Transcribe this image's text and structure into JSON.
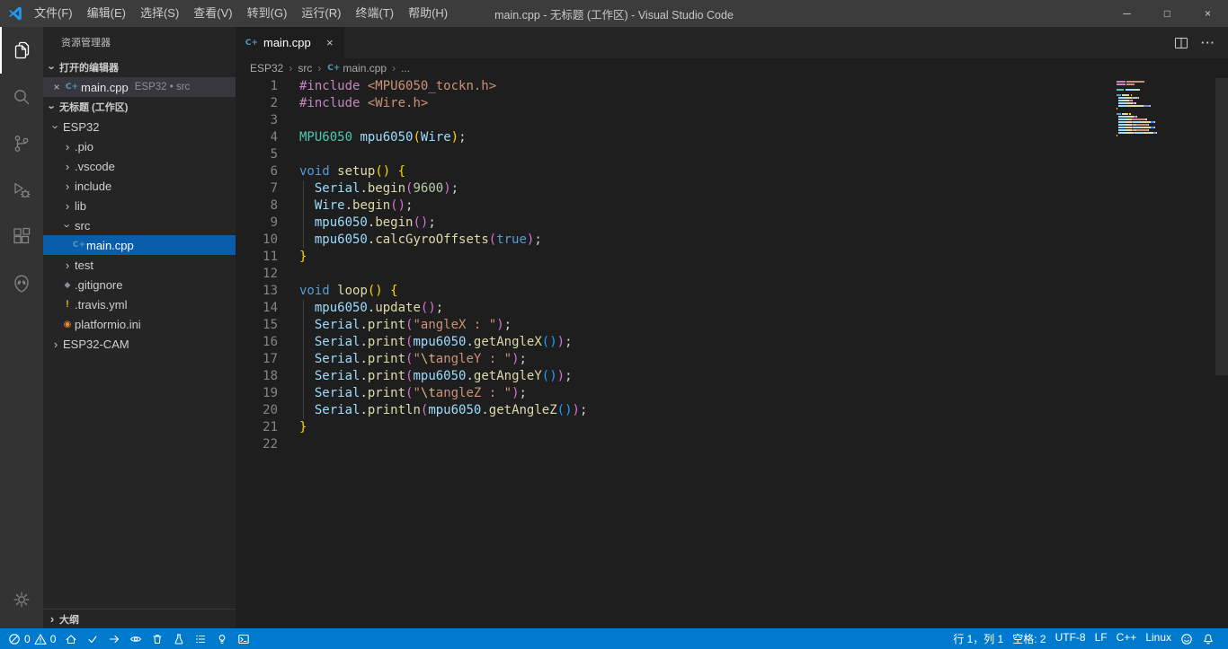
{
  "colors": {
    "status_bar": "#007acc",
    "tree_selection": "#0a5dab",
    "logo_blue": "#1f9cf0",
    "editor_background": "#1e1e1e",
    "sidebar_background": "#252526",
    "activity_bar_background": "#333333",
    "title_bar_background": "#3c3c3c",
    "open_editor_selection": "#37373d"
  },
  "icons": {
    "cpp_badge": "C+",
    "chevron": "›",
    "bullet": "•",
    "close": "×",
    "git_diamond": "◆",
    "travis_mark": "!",
    "pio_ini_mark": "◉",
    "more_actions": "···"
  },
  "title_bar": {
    "title": "main.cpp - 无标题 (工作区) - Visual Studio Code",
    "menus": [
      "文件(F)",
      "编辑(E)",
      "选择(S)",
      "查看(V)",
      "转到(G)",
      "运行(R)",
      "终端(T)",
      "帮助(H)"
    ],
    "window_controls": {
      "minimize": "─",
      "maximize": "□",
      "close": "×"
    }
  },
  "sidebar": {
    "title": "资源管理器",
    "open_editors": {
      "header": "打开的编辑器",
      "items": [
        {
          "close": "×",
          "icon": "cpp",
          "name": "main.cpp",
          "detail": "ESP32 • src"
        }
      ]
    },
    "workspace_header": "无标题 (工作区)",
    "tree": [
      {
        "label": "ESP32",
        "depth": 0,
        "chevron": "down"
      },
      {
        "label": ".pio",
        "depth": 1,
        "chevron": "right"
      },
      {
        "label": ".vscode",
        "depth": 1,
        "chevron": "right"
      },
      {
        "label": "include",
        "depth": 1,
        "chevron": "right"
      },
      {
        "label": "lib",
        "depth": 1,
        "chevron": "right"
      },
      {
        "label": "src",
        "depth": 1,
        "chevron": "down"
      },
      {
        "label": "main.cpp",
        "depth": 2,
        "icon": "cpp",
        "selected": true
      },
      {
        "label": "test",
        "depth": 1,
        "chevron": "right"
      },
      {
        "label": ".gitignore",
        "depth": 1,
        "icon": "git"
      },
      {
        "label": ".travis.yml",
        "depth": 1,
        "icon": "travis"
      },
      {
        "label": "platformio.ini",
        "depth": 1,
        "icon": "ini"
      },
      {
        "label": "ESP32-CAM",
        "depth": 0,
        "chevron": "right"
      }
    ],
    "outline_header": "大纲"
  },
  "editor": {
    "tab": {
      "icon": "cpp",
      "label": "main.cpp",
      "close": "×"
    },
    "breadcrumbs": [
      {
        "label": "ESP32"
      },
      {
        "label": "src"
      },
      {
        "label": "main.cpp",
        "icon": "cpp"
      },
      {
        "label": "..."
      }
    ],
    "lines": [
      {
        "t": [
          [
            "#include",
            "pp"
          ],
          [
            " ",
            ""
          ],
          [
            "<MPU6050_tockn.h>",
            "str"
          ]
        ]
      },
      {
        "t": [
          [
            "#include",
            "pp"
          ],
          [
            " ",
            ""
          ],
          [
            "<Wire.h>",
            "str"
          ]
        ]
      },
      {
        "t": []
      },
      {
        "t": [
          [
            "MPU6050",
            "type"
          ],
          [
            " ",
            ""
          ],
          [
            "mpu6050",
            "var"
          ],
          [
            "(",
            "b1"
          ],
          [
            "Wire",
            "var"
          ],
          [
            ")",
            "b1"
          ],
          [
            ";",
            "pl"
          ]
        ]
      },
      {
        "t": []
      },
      {
        "t": [
          [
            "void",
            "kw"
          ],
          [
            " ",
            ""
          ],
          [
            "setup",
            "fn"
          ],
          [
            "()",
            "b1"
          ],
          [
            " ",
            ""
          ],
          [
            "{",
            "b1"
          ]
        ]
      },
      {
        "g": 1,
        "t": [
          [
            "  ",
            ""
          ],
          [
            "Serial",
            "var"
          ],
          [
            ".",
            "pl"
          ],
          [
            "begin",
            "fn"
          ],
          [
            "(",
            "b2"
          ],
          [
            "9600",
            "num"
          ],
          [
            ")",
            "b2"
          ],
          [
            ";",
            "pl"
          ]
        ]
      },
      {
        "g": 1,
        "t": [
          [
            "  ",
            ""
          ],
          [
            "Wire",
            "var"
          ],
          [
            ".",
            "pl"
          ],
          [
            "begin",
            "fn"
          ],
          [
            "()",
            "b2"
          ],
          [
            ";",
            "pl"
          ]
        ]
      },
      {
        "g": 1,
        "t": [
          [
            "  ",
            ""
          ],
          [
            "mpu6050",
            "var"
          ],
          [
            ".",
            "pl"
          ],
          [
            "begin",
            "fn"
          ],
          [
            "()",
            "b2"
          ],
          [
            ";",
            "pl"
          ]
        ]
      },
      {
        "g": 1,
        "t": [
          [
            "  ",
            ""
          ],
          [
            "mpu6050",
            "var"
          ],
          [
            ".",
            "pl"
          ],
          [
            "calcGyroOffsets",
            "fn"
          ],
          [
            "(",
            "b2"
          ],
          [
            "true",
            "kw"
          ],
          [
            ")",
            "b2"
          ],
          [
            ";",
            "pl"
          ]
        ]
      },
      {
        "t": [
          [
            "}",
            "b1"
          ]
        ]
      },
      {
        "t": []
      },
      {
        "t": [
          [
            "void",
            "kw"
          ],
          [
            " ",
            ""
          ],
          [
            "loop",
            "fn"
          ],
          [
            "()",
            "b1"
          ],
          [
            " ",
            ""
          ],
          [
            "{",
            "b1"
          ]
        ]
      },
      {
        "g": 1,
        "t": [
          [
            "  ",
            ""
          ],
          [
            "mpu6050",
            "var"
          ],
          [
            ".",
            "pl"
          ],
          [
            "update",
            "fn"
          ],
          [
            "()",
            "b2"
          ],
          [
            ";",
            "pl"
          ]
        ]
      },
      {
        "g": 1,
        "t": [
          [
            "  ",
            ""
          ],
          [
            "Serial",
            "var"
          ],
          [
            ".",
            "pl"
          ],
          [
            "print",
            "fn"
          ],
          [
            "(",
            "b2"
          ],
          [
            "\"angleX : \"",
            "str"
          ],
          [
            ")",
            "b2"
          ],
          [
            ";",
            "pl"
          ]
        ]
      },
      {
        "g": 1,
        "t": [
          [
            "  ",
            ""
          ],
          [
            "Serial",
            "var"
          ],
          [
            ".",
            "pl"
          ],
          [
            "print",
            "fn"
          ],
          [
            "(",
            "b2"
          ],
          [
            "mpu6050",
            "var"
          ],
          [
            ".",
            "pl"
          ],
          [
            "getAngleX",
            "fn"
          ],
          [
            "()",
            "b3"
          ],
          [
            ")",
            "b2"
          ],
          [
            ";",
            "pl"
          ]
        ]
      },
      {
        "g": 1,
        "t": [
          [
            "  ",
            ""
          ],
          [
            "Serial",
            "var"
          ],
          [
            ".",
            "pl"
          ],
          [
            "print",
            "fn"
          ],
          [
            "(",
            "b2"
          ],
          [
            "\"",
            "str"
          ],
          [
            "\\t",
            "esc"
          ],
          [
            "angleY : \"",
            "str"
          ],
          [
            ")",
            "b2"
          ],
          [
            ";",
            "pl"
          ]
        ]
      },
      {
        "g": 1,
        "t": [
          [
            "  ",
            ""
          ],
          [
            "Serial",
            "var"
          ],
          [
            ".",
            "pl"
          ],
          [
            "print",
            "fn"
          ],
          [
            "(",
            "b2"
          ],
          [
            "mpu6050",
            "var"
          ],
          [
            ".",
            "pl"
          ],
          [
            "getAngleY",
            "fn"
          ],
          [
            "()",
            "b3"
          ],
          [
            ")",
            "b2"
          ],
          [
            ";",
            "pl"
          ]
        ]
      },
      {
        "g": 1,
        "t": [
          [
            "  ",
            ""
          ],
          [
            "Serial",
            "var"
          ],
          [
            ".",
            "pl"
          ],
          [
            "print",
            "fn"
          ],
          [
            "(",
            "b2"
          ],
          [
            "\"",
            "str"
          ],
          [
            "\\t",
            "esc"
          ],
          [
            "angleZ : \"",
            "str"
          ],
          [
            ")",
            "b2"
          ],
          [
            ";",
            "pl"
          ]
        ]
      },
      {
        "g": 1,
        "t": [
          [
            "  ",
            ""
          ],
          [
            "Serial",
            "var"
          ],
          [
            ".",
            "pl"
          ],
          [
            "println",
            "fn"
          ],
          [
            "(",
            "b2"
          ],
          [
            "mpu6050",
            "var"
          ],
          [
            ".",
            "pl"
          ],
          [
            "getAngleZ",
            "fn"
          ],
          [
            "()",
            "b3"
          ],
          [
            ")",
            "b2"
          ],
          [
            ";",
            "pl"
          ]
        ]
      },
      {
        "t": [
          [
            "}",
            "b1"
          ]
        ]
      },
      {
        "t": []
      }
    ]
  },
  "status_bar": {
    "problems": {
      "errors": "0",
      "warnings": "0"
    },
    "left_icon_names": [
      "home",
      "check",
      "arrow-right",
      "eye",
      "trash",
      "beaker",
      "checklist",
      "lightbulb",
      "terminal"
    ],
    "right": {
      "cursor": "行 1，列 1",
      "spaces": "空格: 2",
      "encoding": "UTF-8",
      "eol": "LF",
      "language": "C++",
      "platform": "Linux"
    }
  }
}
